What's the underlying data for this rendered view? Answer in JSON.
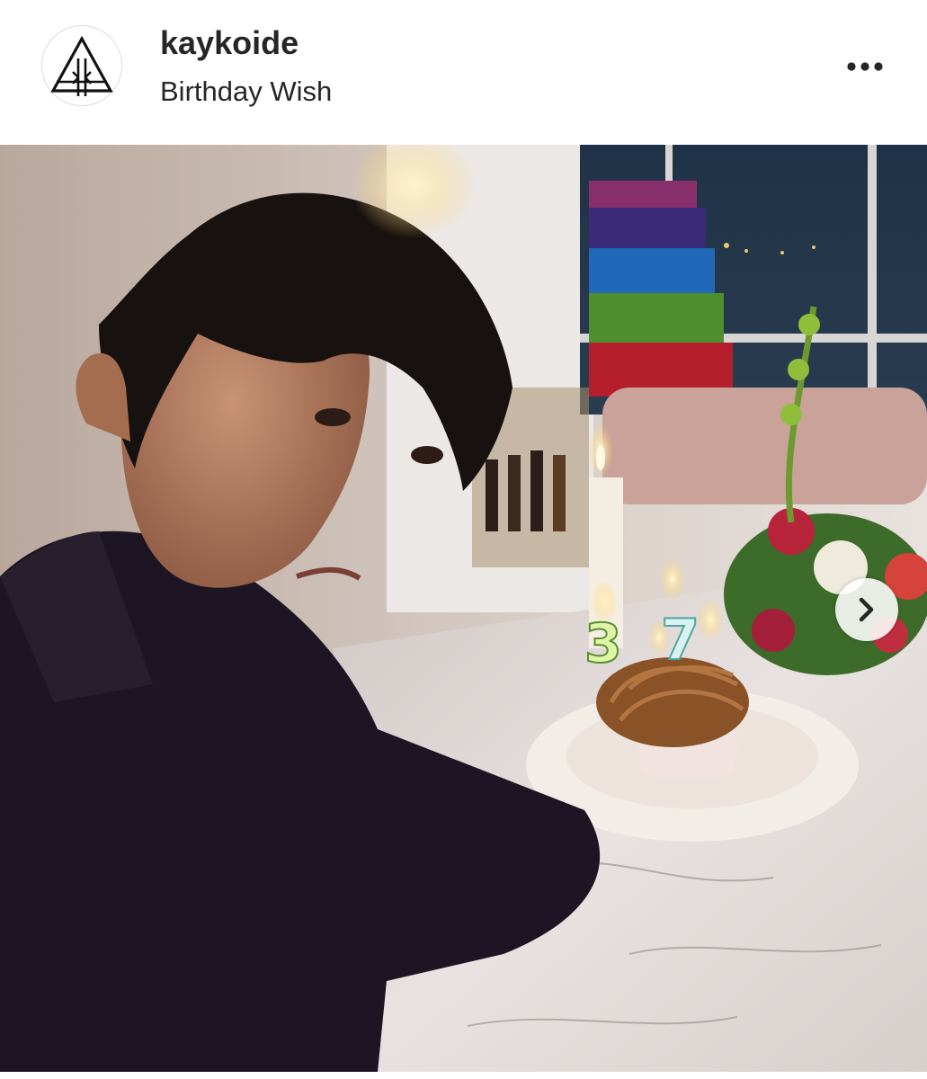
{
  "post": {
    "username": "kaykoide",
    "location": "Birthday Wish"
  },
  "icons": {
    "avatar_logo": "kk-triangle-logo-icon",
    "more": "more-horizontal-icon",
    "next": "chevron-right-icon"
  },
  "colors": {
    "text": "#262626",
    "background": "#ffffff",
    "avatar_border": "#dbdbdb"
  }
}
